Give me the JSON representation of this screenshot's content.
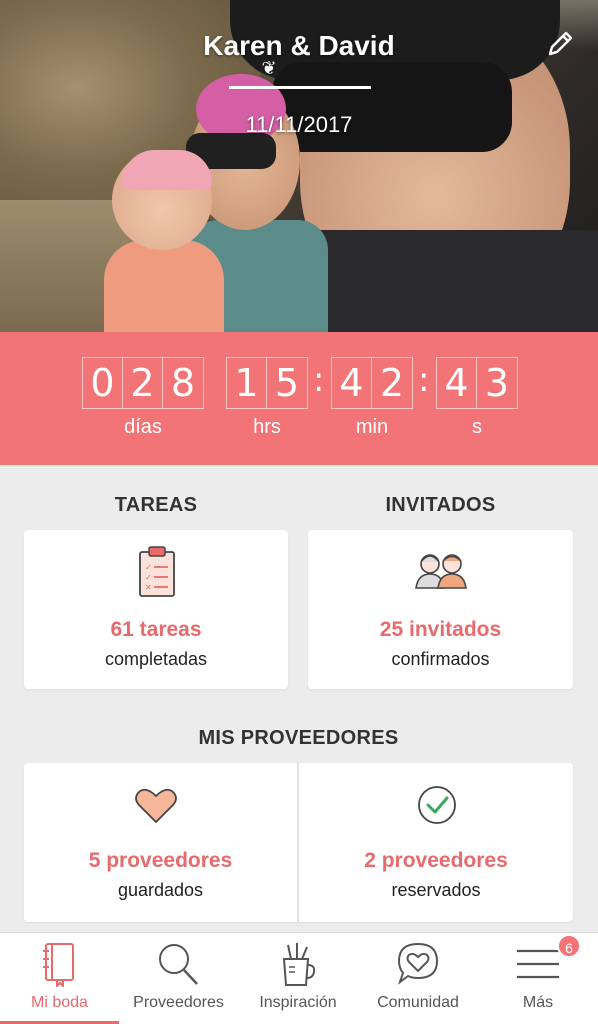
{
  "header": {
    "couple_names": "Karen & David",
    "wedding_date": "11/11/2017"
  },
  "countdown": {
    "days": [
      "0",
      "2",
      "8"
    ],
    "hours": [
      "1",
      "5"
    ],
    "minutes": [
      "4",
      "2"
    ],
    "seconds": [
      "4",
      "3"
    ],
    "separator": ":",
    "labels": {
      "days": "días",
      "hours": "hrs",
      "minutes": "min",
      "seconds": "s"
    }
  },
  "tasks": {
    "title": "TAREAS",
    "count": "61 tareas",
    "status": "completadas"
  },
  "guests": {
    "title": "INVITADOS",
    "count": "25 invitados",
    "status": "confirmados"
  },
  "vendors": {
    "title": "MIS PROVEEDORES",
    "saved": {
      "count": "5 proveedores",
      "status": "guardados"
    },
    "booked": {
      "count": "2 proveedores",
      "status": "reservados"
    }
  },
  "nav": {
    "items": [
      {
        "label": "Mi boda",
        "icon": "notebook-icon"
      },
      {
        "label": "Proveedores",
        "icon": "search-icon"
      },
      {
        "label": "Inspiración",
        "icon": "cup-pencil-icon"
      },
      {
        "label": "Comunidad",
        "icon": "chat-heart-icon"
      },
      {
        "label": "Más",
        "icon": "menu-icon"
      }
    ],
    "more_badge": "6"
  },
  "colors": {
    "accent": "#f27476",
    "accent_text": "#e86a6c",
    "check_green": "#3aaa5a"
  }
}
